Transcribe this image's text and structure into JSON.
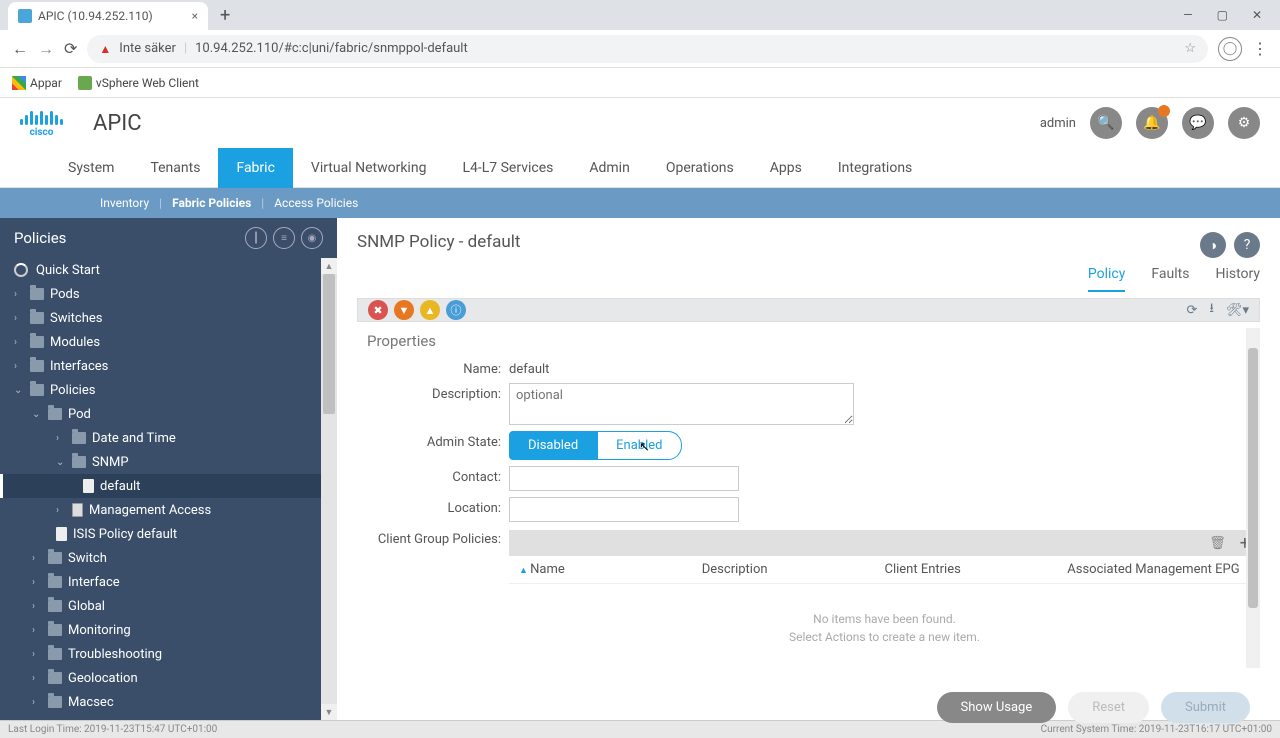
{
  "browser": {
    "tab_title": "APIC (10.94.252.110)",
    "url_warn": "Inte säker",
    "url": "10.94.252.110/#c:c|uni/fabric/snmppol-default",
    "bookmarks": {
      "apps": "Appar",
      "vsphere": "vSphere Web Client"
    }
  },
  "header": {
    "logo_text": "cisco",
    "title": "APIC",
    "user": "admin"
  },
  "main_nav": [
    "System",
    "Tenants",
    "Fabric",
    "Virtual Networking",
    "L4-L7 Services",
    "Admin",
    "Operations",
    "Apps",
    "Integrations"
  ],
  "sub_nav": [
    "Inventory",
    "Fabric Policies",
    "Access Policies"
  ],
  "sidebar": {
    "title": "Policies",
    "quick_start": "Quick Start",
    "items": [
      "Pods",
      "Switches",
      "Modules",
      "Interfaces",
      "Policies"
    ],
    "policies_children": {
      "pod": "Pod",
      "date_time": "Date and Time",
      "snmp": "SNMP",
      "snmp_default": "default",
      "mgmt_access": "Management Access",
      "isis": "ISIS Policy default",
      "switch": "Switch",
      "interface": "Interface",
      "global": "Global",
      "monitoring": "Monitoring",
      "troubleshooting": "Troubleshooting",
      "geolocation": "Geolocation",
      "macsec": "Macsec"
    }
  },
  "page": {
    "title": "SNMP Policy - default",
    "tabs": [
      "Policy",
      "Faults",
      "History"
    ],
    "properties_title": "Properties",
    "labels": {
      "name": "Name:",
      "description": "Description:",
      "admin_state": "Admin State:",
      "contact": "Contact:",
      "location": "Location:",
      "cgp": "Client Group Policies:"
    },
    "values": {
      "name": "default"
    },
    "placeholders": {
      "description": "optional"
    },
    "toggle": {
      "disabled": "Disabled",
      "enabled": "Enabled"
    },
    "table_cols": [
      "Name",
      "Description",
      "Client Entries",
      "Associated Management EPG"
    ],
    "empty": {
      "line1": "No items have been found.",
      "line2": "Select Actions to create a new item."
    },
    "buttons": {
      "show_usage": "Show Usage",
      "reset": "Reset",
      "submit": "Submit"
    }
  },
  "statusbar": {
    "left": "Last Login Time: 2019-11-23T15:47 UTC+01:00",
    "right": "Current System Time: 2019-11-23T16:17 UTC+01:00"
  }
}
